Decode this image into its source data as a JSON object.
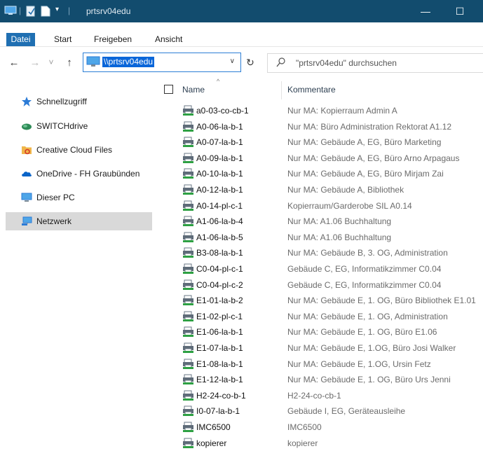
{
  "window": {
    "title": "prtsrv04edu",
    "minimize_symbol": "—",
    "maximize_symbol": "☐"
  },
  "ribbon": {
    "tabs": [
      {
        "label": "Datei",
        "active": true
      },
      {
        "label": "Start",
        "active": false
      },
      {
        "label": "Freigeben",
        "active": false
      },
      {
        "label": "Ansicht",
        "active": false
      }
    ]
  },
  "nav": {
    "back_symbol": "←",
    "forward_symbol": "→",
    "recent_symbol": "˅",
    "up_symbol": "↑",
    "refresh_symbol": "↻",
    "dropdown_symbol": "∨"
  },
  "address": {
    "value": "\\\\prtsrv04edu"
  },
  "search": {
    "placeholder": "\"prtsrv04edu\" durchsuchen"
  },
  "sidebar": {
    "items": [
      {
        "label": "Schnellzugriff",
        "icon": "star-icon",
        "color": "#2b7bd6",
        "selected": false
      },
      {
        "label": "SWITCHdrive",
        "icon": "switchdrive-icon",
        "color": "#2e8b57",
        "selected": false
      },
      {
        "label": "Creative Cloud Files",
        "icon": "creative-cloud-folder-icon",
        "color": "#e8a33d",
        "selected": false
      },
      {
        "label": "OneDrive - FH Graubünden",
        "icon": "onedrive-cloud-icon",
        "color": "#0a64c8",
        "selected": false
      },
      {
        "label": "Dieser PC",
        "icon": "computer-icon",
        "color": "#3b8fd9",
        "selected": false
      },
      {
        "label": "Netzwerk",
        "icon": "network-icon",
        "color": "#3b8fd9",
        "selected": true
      }
    ]
  },
  "columns": {
    "name": "Name",
    "comment": "Kommentare",
    "sort_symbol": "^"
  },
  "files": [
    {
      "name": "a0-03-co-cb-1",
      "comment": "Nur MA: Kopierraum Admin A"
    },
    {
      "name": "A0-06-la-b-1",
      "comment": "Nur MA: Büro Administration Rektorat A1.12"
    },
    {
      "name": "A0-07-la-b-1",
      "comment": "Nur MA: Gebäude A, EG, Büro Marketing"
    },
    {
      "name": "A0-09-la-b-1",
      "comment": "Nur MA: Gebäude A, EG, Büro Arno Arpagaus"
    },
    {
      "name": "A0-10-la-b-1",
      "comment": "Nur MA: Gebäude A, EG, Büro Mirjam Zai"
    },
    {
      "name": "A0-12-la-b-1",
      "comment": "Nur MA: Gebäude A, Bibliothek"
    },
    {
      "name": "A0-14-pl-c-1",
      "comment": "Kopierraum/Garderobe SIL A0.14"
    },
    {
      "name": "A1-06-la-b-4",
      "comment": "Nur MA: A1.06 Buchhaltung"
    },
    {
      "name": "A1-06-la-b-5",
      "comment": "Nur MA: A1.06 Buchhaltung"
    },
    {
      "name": "B3-08-la-b-1",
      "comment": "Nur MA: Gebäude B, 3. OG, Administration"
    },
    {
      "name": "C0-04-pl-c-1",
      "comment": "Gebäude C, EG, Informatikzimmer C0.04"
    },
    {
      "name": "C0-04-pl-c-2",
      "comment": "Gebäude C, EG, Informatikzimmer C0.04"
    },
    {
      "name": "E1-01-la-b-2",
      "comment": "Nur MA: Gebäude E, 1. OG, Büro Bibliothek E1.01"
    },
    {
      "name": "E1-02-pl-c-1",
      "comment": "Nur MA: Gebäude E, 1. OG, Administration"
    },
    {
      "name": "E1-06-la-b-1",
      "comment": "Nur MA: Gebäude E, 1. OG, Büro E1.06"
    },
    {
      "name": "E1-07-la-b-1",
      "comment": "Nur MA: Gebäude E, 1.OG, Büro Josi Walker"
    },
    {
      "name": "E1-08-la-b-1",
      "comment": "Nur MA: Gebäude E, 1.OG, Ursin Fetz"
    },
    {
      "name": "E1-12-la-b-1",
      "comment": "Nur MA: Gebäude E, 1. OG, Büro Urs Jenni"
    },
    {
      "name": "H2-24-co-b-1",
      "comment": "H2-24-co-cb-1"
    },
    {
      "name": "I0-07-la-b-1",
      "comment": "Gebäude I, EG, Geräteausleihe"
    },
    {
      "name": "IMC6500",
      "comment": "IMC6500"
    },
    {
      "name": "kopierer",
      "comment": "kopierer"
    }
  ]
}
